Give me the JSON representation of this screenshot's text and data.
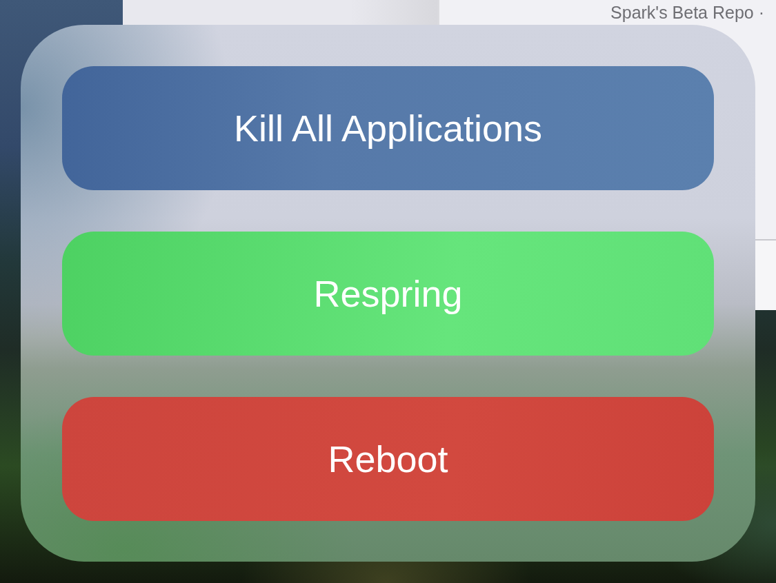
{
  "background_window": {
    "subtitle": "Spark's Beta Repo ·"
  },
  "action_sheet": {
    "buttons": [
      {
        "label": "Kill All Applications",
        "kind": "neutral"
      },
      {
        "label": "Respring",
        "kind": "confirm"
      },
      {
        "label": "Reboot",
        "kind": "destructive"
      }
    ]
  }
}
